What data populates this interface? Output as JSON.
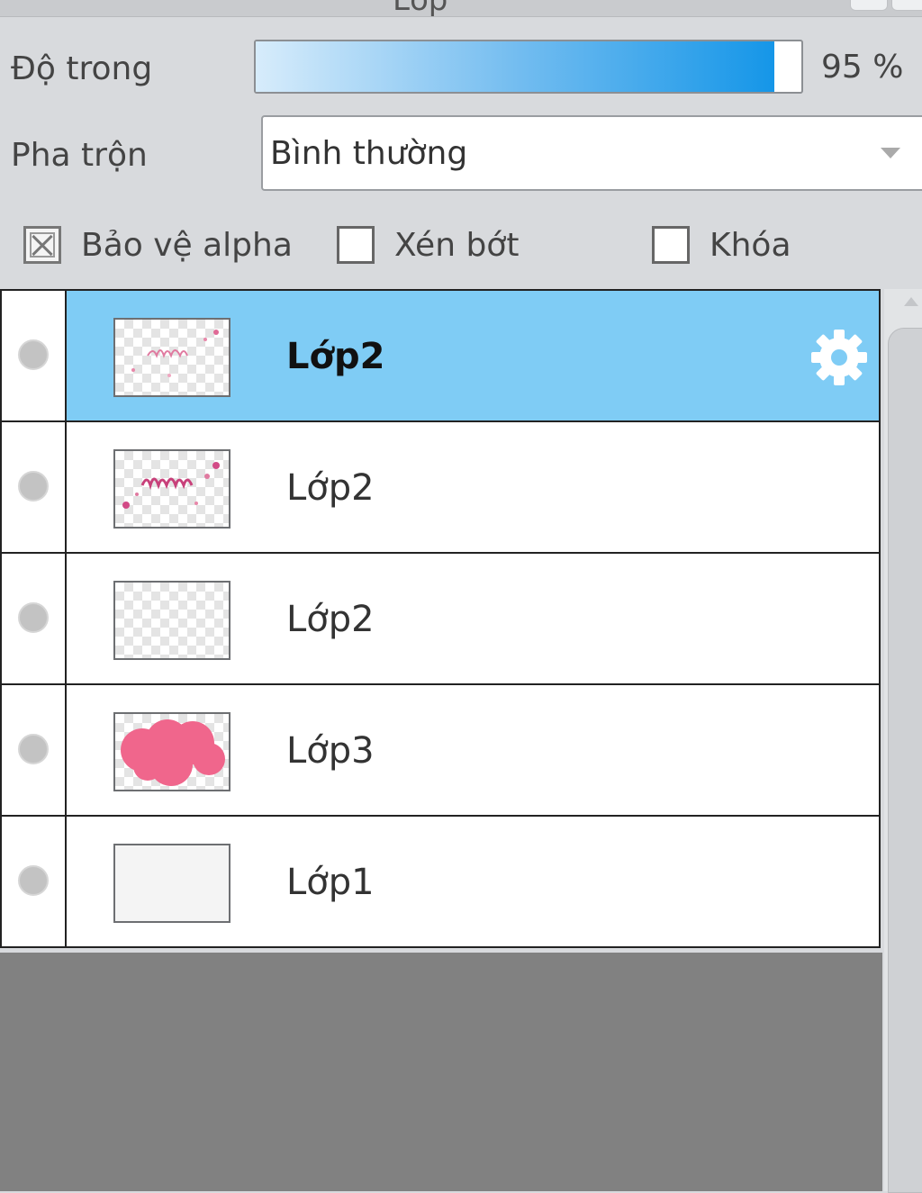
{
  "panel": {
    "title_fragment": "Lớp"
  },
  "opacity": {
    "label": "Độ trong",
    "value": 95,
    "value_text": "95 %"
  },
  "blend": {
    "label": "Pha trộn",
    "value": "Bình thường"
  },
  "options": [
    {
      "label": "Bảo vệ alpha",
      "checked": true
    },
    {
      "label": "Xén bớt",
      "checked": false
    },
    {
      "label": "Khóa",
      "checked": false
    }
  ],
  "layers": [
    {
      "name": "Lớp2",
      "selected": true,
      "thumbnail": "pink-scribble"
    },
    {
      "name": "Lớp2",
      "selected": false,
      "thumbnail": "pink-scribble-dots"
    },
    {
      "name": "Lớp2",
      "selected": false,
      "thumbnail": "transparent"
    },
    {
      "name": "Lớp3",
      "selected": false,
      "thumbnail": "pink-cloud"
    },
    {
      "name": "Lớp1",
      "selected": false,
      "thumbnail": "blank-white"
    }
  ],
  "colors": {
    "selected_row": "#7fccf5",
    "opacity_fill": "#1596e8",
    "cloud_pink": "#f0668c"
  },
  "icons": {
    "visibility": "circle-icon",
    "layer_settings": "gear-icon"
  }
}
